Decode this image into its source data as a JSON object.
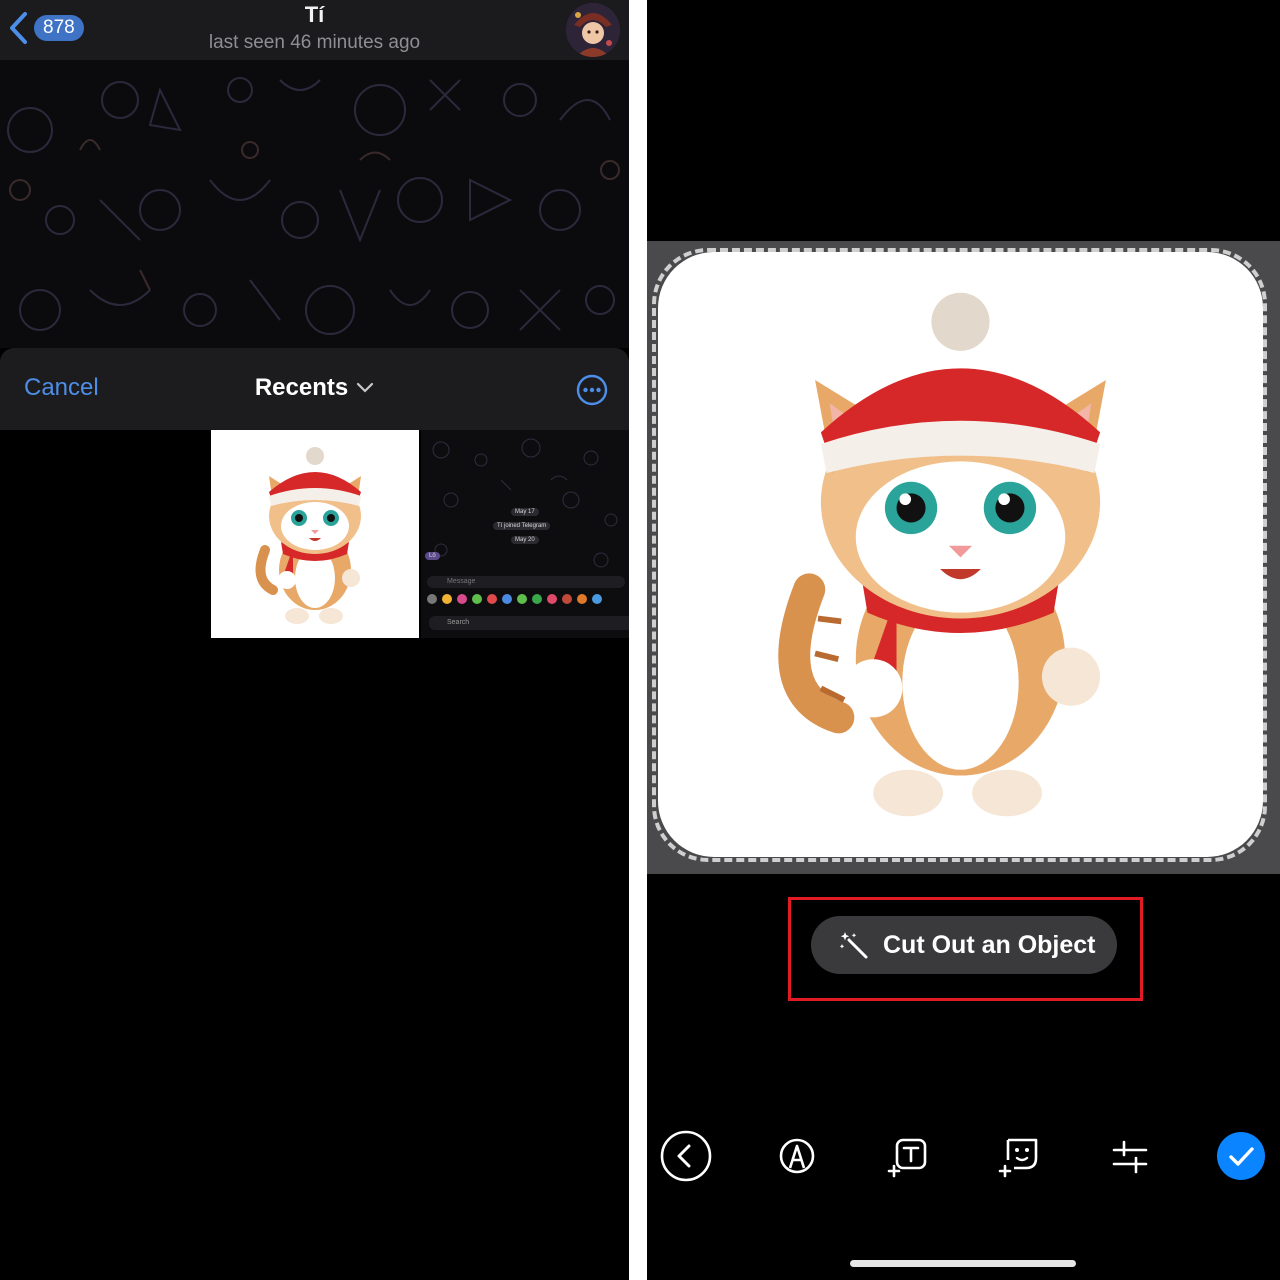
{
  "left_screen": {
    "header": {
      "back_count": "878",
      "title": "Tí",
      "status": "last seen 46 minutes ago"
    },
    "picker": {
      "cancel_label": "Cancel",
      "title": "Recents",
      "thumb2": {
        "date1": "May 17",
        "joined": "Tí joined Telegram",
        "date2": "May 20",
        "bubble": "Lô",
        "input_placeholder": "Message",
        "search_label": "Search"
      }
    }
  },
  "right_screen": {
    "cutout_button": "Cut Out an Object",
    "tools": [
      "back-icon",
      "draw-icon",
      "text-icon",
      "sticker-icon",
      "adjust-icon",
      "done-icon"
    ]
  },
  "colors": {
    "accent_blue": "#4c8ee8",
    "done_blue": "#0a84ff",
    "highlight_red": "#e01b24",
    "badge_blue": "#3f73c6"
  }
}
